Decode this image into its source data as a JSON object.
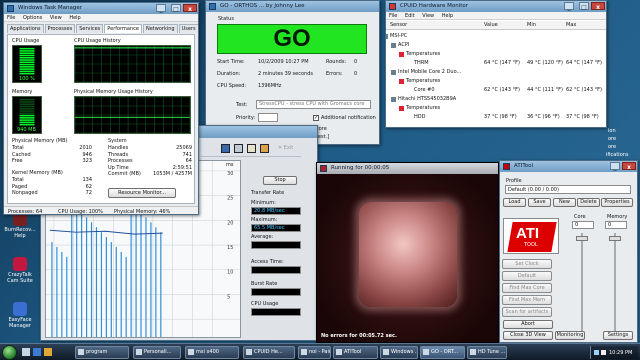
{
  "desktop_icons": [
    {
      "label": "BurnRecov... Help",
      "color": "#7a1f1f"
    },
    {
      "label": "CrazyTalk Cam Suite",
      "color": "#c2183f"
    },
    {
      "label": "EasyFace Manager",
      "color": "#3a6ed1"
    }
  ],
  "task_manager": {
    "title": "Windows Task Manager",
    "menu": [
      "File",
      "Options",
      "View",
      "Help"
    ],
    "tabs": [
      "Applications",
      "Processes",
      "Services",
      "Performance",
      "Networking",
      "Users"
    ],
    "active_tab": "Performance",
    "cpu_usage_label": "CPU Usage",
    "cpu_usage_value": "100 %",
    "cpu_history_label": "CPU Usage History",
    "memory_label": "Memory",
    "memory_value": "940 MB",
    "mem_history_label": "Physical Memory Usage History",
    "physical_memory": {
      "label": "Physical Memory (MB)",
      "rows": [
        [
          "Total",
          "2010"
        ],
        [
          "Cached",
          "946"
        ],
        [
          "Free",
          "323"
        ]
      ]
    },
    "kernel_memory": {
      "label": "Kernel Memory (MB)",
      "rows": [
        [
          "Total",
          "134"
        ],
        [
          "Paged",
          "62"
        ],
        [
          "Nonpaged",
          "72"
        ]
      ]
    },
    "system": {
      "label": "System",
      "rows": [
        [
          "Handles",
          "25069"
        ],
        [
          "Threads",
          "741"
        ],
        [
          "Processes",
          "64"
        ],
        [
          "Up Time",
          "2:59:51"
        ],
        [
          "Commit (MB)",
          "1053M / 4257M"
        ]
      ]
    },
    "resource_monitor_button": "Resource Monitor...",
    "status": [
      "Processes: 64",
      "CPU Usage: 100%",
      "Physical Memory: 46%"
    ],
    "cpu_usage_fraction": 1.0
  },
  "occt": {
    "title": "GO - ORTHOS ... by Johnny Lee",
    "status_label": "Status",
    "status_value": "GO",
    "start_time_label": "Start Time:",
    "start_time_value": "10/2/2009 10:27 PM",
    "rounds_label": "Rounds:",
    "rounds_value": "0",
    "duration_label": "Duration:",
    "duration_value": "2 minutes 39 seconds",
    "errors_label": "Errors:",
    "errors_value": "0",
    "cpu_speed_label": "CPU Speed:",
    "cpu_speed_value": "1396MHz",
    "test_label": "Test:",
    "test_value": "StressCPU - stress CPU with Gromacs core",
    "priority_label": "Priority:",
    "additional_notification": "Additional notification",
    "core_text": "core",
    "test_text": "test.]"
  },
  "cpuid": {
    "title": "CPUID Hardware Monitor",
    "menu": [
      "File",
      "Edit",
      "View",
      "Help"
    ],
    "columns": [
      "Sensor",
      "Value",
      "Min",
      "Max"
    ],
    "rows": [
      {
        "indent": 0,
        "name": "MSI-PC",
        "value": "",
        "min": "",
        "max": "",
        "icon": "computer-icon"
      },
      {
        "indent": 1,
        "name": "ACPI",
        "value": "",
        "min": "",
        "max": "",
        "icon": "chip-icon"
      },
      {
        "indent": 2,
        "name": "Temperatures",
        "value": "",
        "min": "",
        "max": "",
        "icon": "thermometer-icon"
      },
      {
        "indent": 3,
        "name": "THRM",
        "value": "64 °C (147 °F)",
        "min": "49 °C (120 °F)",
        "max": "64 °C (147 °F)",
        "icon": ""
      },
      {
        "indent": 1,
        "name": "Intel Mobile Core 2 Duo...",
        "value": "",
        "min": "",
        "max": "",
        "icon": "cpu-icon"
      },
      {
        "indent": 2,
        "name": "Temperatures",
        "value": "",
        "min": "",
        "max": "",
        "icon": "thermometer-icon"
      },
      {
        "indent": 3,
        "name": "Core #0",
        "value": "62 °C (143 °F)",
        "min": "44 °C (111 °F)",
        "max": "62 °C (143 °F)",
        "icon": ""
      },
      {
        "indent": 1,
        "name": "Hitachi HTS545032B9A",
        "value": "",
        "min": "",
        "max": "",
        "icon": "disk-icon"
      },
      {
        "indent": 2,
        "name": "Temperatures",
        "value": "",
        "min": "",
        "max": "",
        "icon": "thermometer-icon"
      },
      {
        "indent": 3,
        "name": "HDD",
        "value": "37 °C (98 °F)",
        "min": "36 °C (96 °F)",
        "max": "37 °C (98 °F)",
        "icon": ""
      }
    ]
  },
  "hd_tune": {
    "stop_button": "Stop",
    "transfer_rate_label": "Transfer Rate",
    "minimum_label": "Minimum:",
    "minimum_value": "20.8 MB/sec",
    "maximum_label": "Maximum:",
    "maximum_value": "65.5 MB/sec",
    "average_label": "Average:",
    "access_time_label": "Access Time:",
    "burst_rate_label": "Burst Rate",
    "cpu_usage_label": "CPU Usage",
    "exit_label": "Exit",
    "axis_label_ms": "ms",
    "y_ticks": [
      "30",
      "25",
      "20",
      "15",
      "10",
      "5"
    ]
  },
  "fur": {
    "title": "Running for 00:00:05",
    "status_text": "No errors for 00:05.72 sec."
  },
  "atitool": {
    "title": "ATITool",
    "profile_label": "Profile",
    "profile_value": "Default (0.00 / 0.00)",
    "profile_buttons": [
      "Load",
      "Save",
      "New",
      "Delete",
      "Properties"
    ],
    "core_label": "Core",
    "memory_label": "Memory",
    "core_value": "0",
    "memory_value": "0",
    "logo_text": "ATI",
    "logo_sub": "TOOL",
    "side_buttons": [
      "Set Clock",
      "Default",
      "Find Max Core",
      "Find Max Mem",
      "Scan for artifacts"
    ],
    "abort_button": "Abort",
    "close_3d_view": "Close 3D View",
    "monitoring_button": "Monitoring",
    "settings_button": "Settings"
  },
  "right_edge_text": [
    "ion",
    "ore",
    "ore",
    "ifications"
  ],
  "taskbar": {
    "items": [
      {
        "label": "program",
        "active": false
      },
      {
        "label": "Personali...",
        "active": false
      },
      {
        "label": "msi x400",
        "active": false
      },
      {
        "label": "CPUID He...",
        "active": false
      },
      {
        "label": "noi - Paint",
        "active": false
      },
      {
        "label": "ATITool",
        "active": false
      },
      {
        "label": "Windows ...",
        "active": false
      },
      {
        "label": "GO - ORT...",
        "active": true
      },
      {
        "label": "HD Tune ...",
        "active": false
      }
    ],
    "clock": "10:29 PM"
  }
}
